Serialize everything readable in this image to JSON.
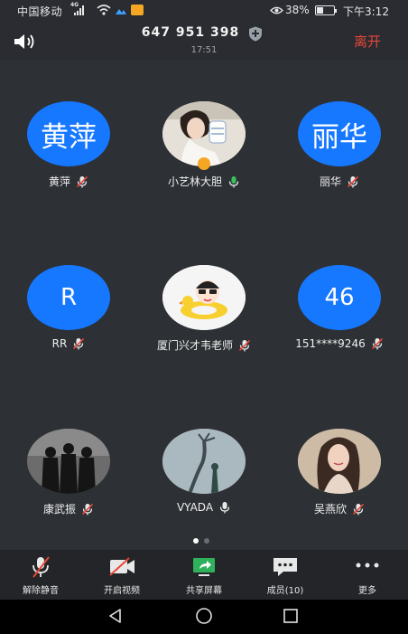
{
  "status_bar": {
    "carrier": "中国移动",
    "network": "4G",
    "battery": "38%",
    "time": "下午3:12"
  },
  "header": {
    "meeting_id": "647 951 398",
    "duration": "17:51",
    "leave_label": "离开"
  },
  "participants": [
    {
      "name": "黄萍",
      "avatar_text": "黄萍",
      "avatar_type": "text",
      "mic": "muted"
    },
    {
      "name": "小艺林大胆",
      "avatar_type": "photo",
      "mic": "active",
      "host": true
    },
    {
      "name": "丽华",
      "avatar_text": "丽华",
      "avatar_type": "text",
      "mic": "muted"
    },
    {
      "name": "RR",
      "avatar_text": "R",
      "avatar_type": "text",
      "mic": "muted"
    },
    {
      "name": "厦门兴才韦老师",
      "avatar_type": "photo",
      "mic": "muted"
    },
    {
      "name": "151****9246",
      "avatar_text": "46",
      "avatar_type": "text",
      "mic": "muted"
    },
    {
      "name": "康武振",
      "avatar_type": "photo",
      "mic": "muted"
    },
    {
      "name": "VYADA",
      "avatar_type": "photo",
      "mic": "unmuted"
    },
    {
      "name": "吴燕欣",
      "avatar_type": "photo",
      "mic": "muted"
    }
  ],
  "pagination": {
    "current": 1,
    "total": 2
  },
  "toolbar": {
    "unmute": "解除静音",
    "start_video": "开启视频",
    "share_screen": "共享屏幕",
    "members": "成员(10)",
    "more": "更多"
  },
  "colors": {
    "accent": "#1677ff",
    "leave": "#e8463a",
    "share": "#2fb05a",
    "mic_active": "#37c35a"
  }
}
